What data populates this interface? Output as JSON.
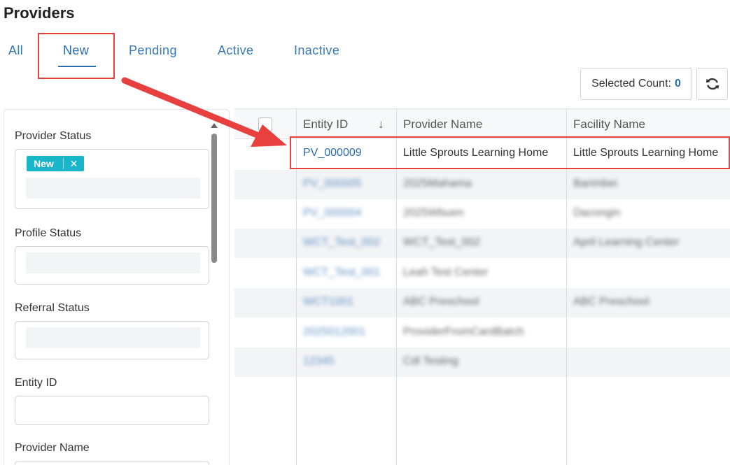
{
  "page": {
    "title": "Providers"
  },
  "tabs": [
    {
      "label": "All"
    },
    {
      "label": "New"
    },
    {
      "label": "Pending"
    },
    {
      "label": "Active"
    },
    {
      "label": "Inactive"
    }
  ],
  "toolbar": {
    "selected_count_label": "Selected Count:",
    "selected_count_value": "0"
  },
  "filters": {
    "provider_status": {
      "label": "Provider Status",
      "chip": "New",
      "chip_remove": "✕"
    },
    "profile_status": {
      "label": "Profile Status"
    },
    "referral_status": {
      "label": "Referral Status"
    },
    "entity_id": {
      "label": "Entity ID"
    },
    "provider_name": {
      "label": "Provider Name"
    }
  },
  "grid": {
    "columns": [
      "Entity ID",
      "Provider Name",
      "Facility Name"
    ],
    "sort_indicator": "↓",
    "rows": [
      {
        "entity_id": "PV_000009",
        "provider_name": "Little Sprouts Learning Home",
        "facility_name": "Little Sprouts Learning Home"
      },
      {
        "entity_id": "PV_000005",
        "provider_name": "2025Mahama",
        "facility_name": "Barimbei"
      },
      {
        "entity_id": "PV_000004",
        "provider_name": "2025Wbuen",
        "facility_name": "Dacongin"
      },
      {
        "entity_id": "WCT_Test_002",
        "provider_name": "WCT_Test_002",
        "facility_name": "April Learning Center"
      },
      {
        "entity_id": "WCT_Test_001",
        "provider_name": "Leah Test Center",
        "facility_name": ""
      },
      {
        "entity_id": "WCT1001",
        "provider_name": "ABC Preschool",
        "facility_name": "ABC Preschool"
      },
      {
        "entity_id": "2025012001",
        "provider_name": "ProviderFromCardBatch",
        "facility_name": ""
      },
      {
        "entity_id": "12345",
        "provider_name": "Cdl Testing",
        "facility_name": ""
      }
    ]
  },
  "colors": {
    "accent": "#2a6cb0",
    "chip": "#19b5c9",
    "annotation": "#e8403f"
  },
  "icons": {
    "refresh": "refresh-icon",
    "arrow": "annotation-arrow"
  }
}
